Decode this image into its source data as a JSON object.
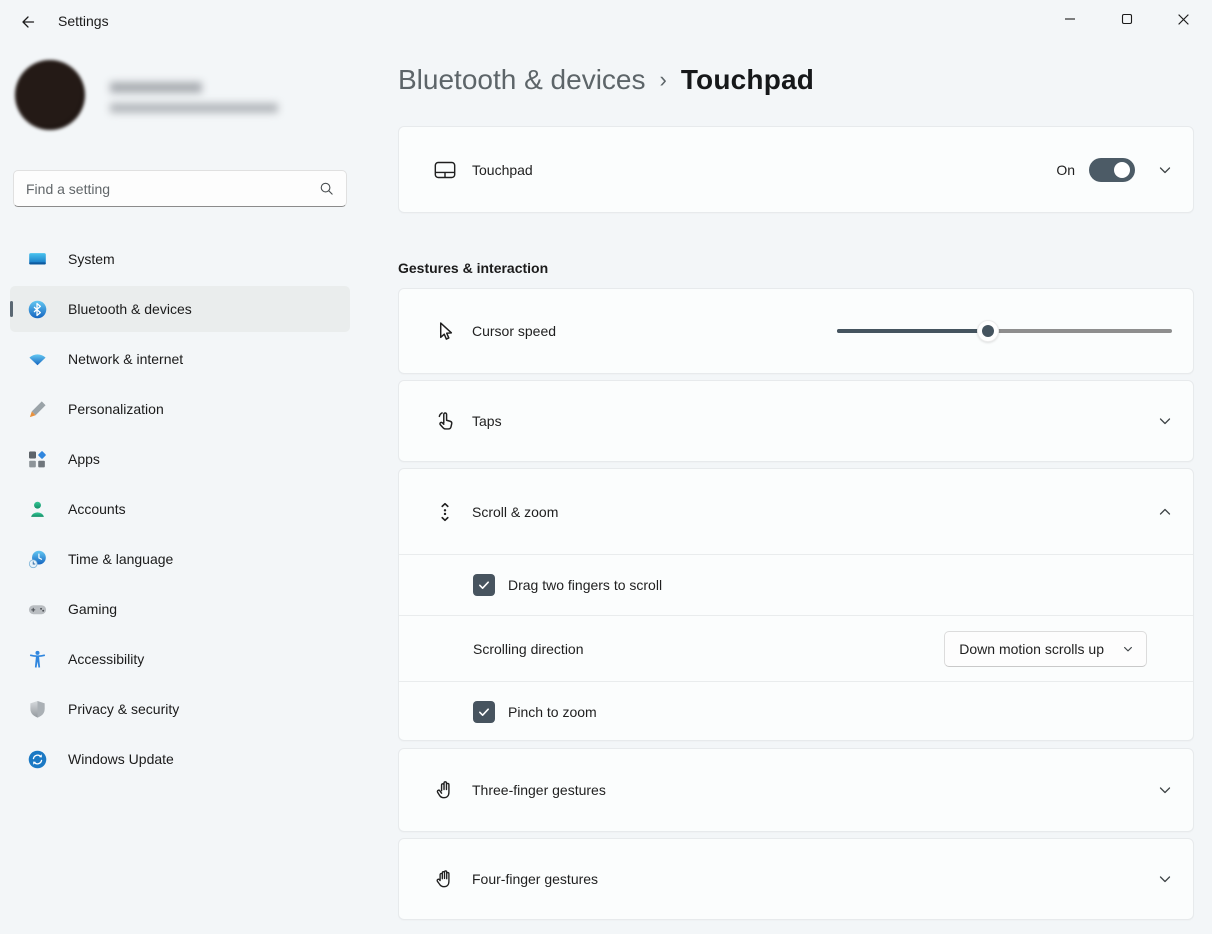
{
  "titlebar": {
    "app_title": "Settings"
  },
  "search": {
    "placeholder": "Find a setting"
  },
  "sidebar": {
    "items": [
      {
        "label": "System",
        "icon": "system-icon",
        "selected": false
      },
      {
        "label": "Bluetooth & devices",
        "icon": "bluetooth-icon",
        "selected": true
      },
      {
        "label": "Network & internet",
        "icon": "network-icon",
        "selected": false
      },
      {
        "label": "Personalization",
        "icon": "personalization-icon",
        "selected": false
      },
      {
        "label": "Apps",
        "icon": "apps-icon",
        "selected": false
      },
      {
        "label": "Accounts",
        "icon": "accounts-icon",
        "selected": false
      },
      {
        "label": "Time & language",
        "icon": "time-language-icon",
        "selected": false
      },
      {
        "label": "Gaming",
        "icon": "gaming-icon",
        "selected": false
      },
      {
        "label": "Accessibility",
        "icon": "accessibility-icon",
        "selected": false
      },
      {
        "label": "Privacy & security",
        "icon": "privacy-security-icon",
        "selected": false
      },
      {
        "label": "Windows Update",
        "icon": "windows-update-icon",
        "selected": false
      }
    ]
  },
  "breadcrumb": {
    "parent": "Bluetooth & devices",
    "separator": "›",
    "current": "Touchpad"
  },
  "main": {
    "touchpad": {
      "label": "Touchpad",
      "status": "On",
      "enabled": true
    },
    "section": {
      "header": "Gestures & interaction"
    },
    "cursor_speed": {
      "label": "Cursor speed",
      "value_percent": 45
    },
    "taps": {
      "label": "Taps",
      "expanded": false
    },
    "scroll_zoom": {
      "label": "Scroll & zoom",
      "expanded": true,
      "rows": [
        {
          "type": "checkbox",
          "label": "Drag two fingers to scroll",
          "checked": true
        },
        {
          "type": "dropdown",
          "label": "Scrolling direction",
          "value": "Down motion scrolls up"
        },
        {
          "type": "checkbox",
          "label": "Pinch to zoom",
          "checked": true
        }
      ]
    },
    "three_finger": {
      "label": "Three-finger gestures",
      "expanded": false
    },
    "four_finger": {
      "label": "Four-finger gestures",
      "expanded": false
    }
  },
  "colors": {
    "accent": "#4c5b66",
    "selected_indicator": "#5a6772",
    "bluetooth_blue": "#1674d4",
    "page_background": "#f3f6f8",
    "card_background": "#fbfdfd"
  }
}
